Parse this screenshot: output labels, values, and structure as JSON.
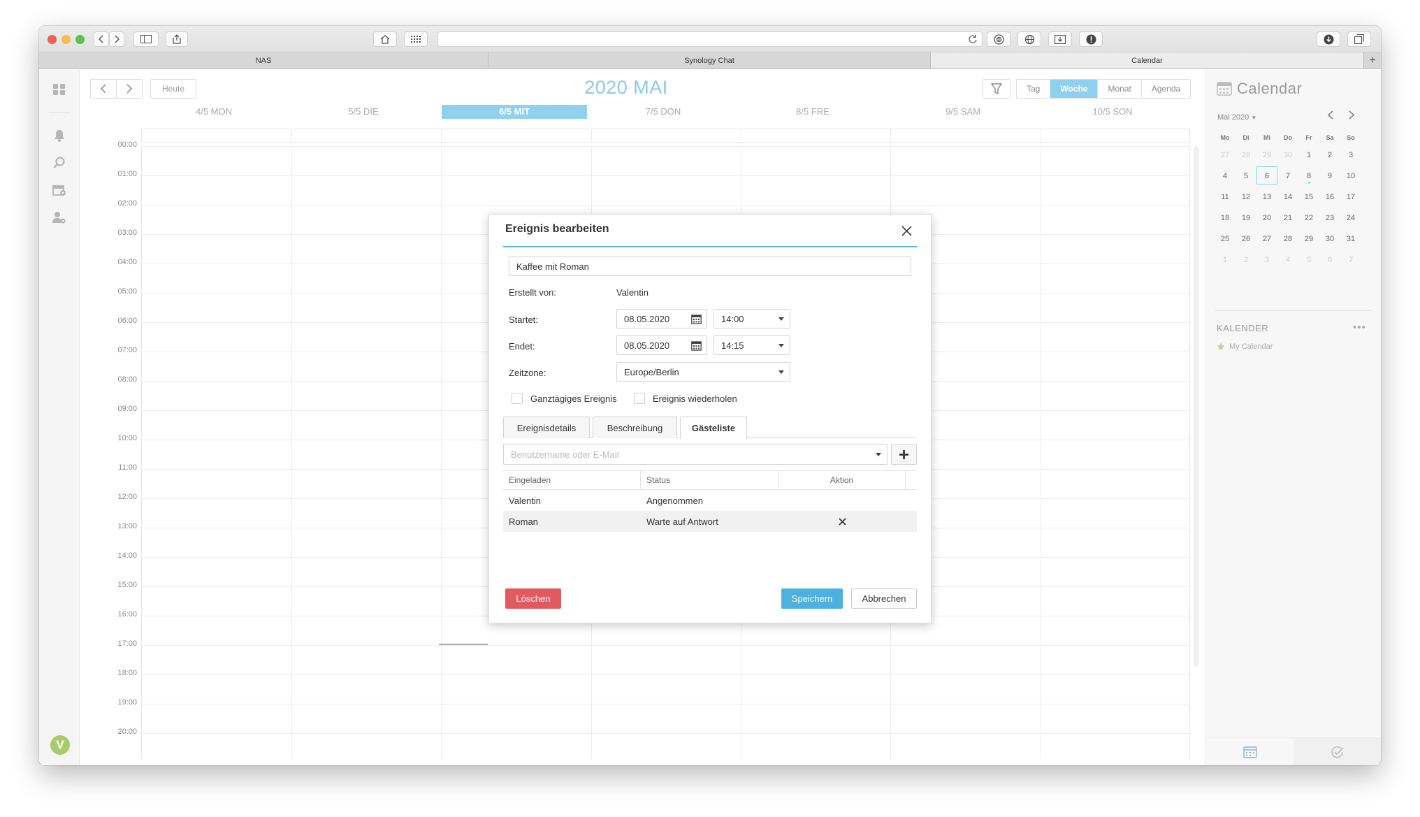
{
  "browser": {
    "tabs": [
      {
        "label": "NAS",
        "active": false
      },
      {
        "label": "Synology Chat",
        "active": false
      },
      {
        "label": "Calendar",
        "active": true
      }
    ],
    "new_tab_label": "+"
  },
  "header": {
    "today_label": "Heute",
    "title": "2020 MAI",
    "views": [
      {
        "label": "Tag",
        "active": false
      },
      {
        "label": "Woche",
        "active": true
      },
      {
        "label": "Monat",
        "active": false
      },
      {
        "label": "Agenda",
        "active": false
      }
    ]
  },
  "week": {
    "days": [
      {
        "label": "4/5 MON",
        "today": false
      },
      {
        "label": "5/5 DIE",
        "today": false
      },
      {
        "label": "6/5 MIT",
        "today": true
      },
      {
        "label": "7/5 DON",
        "today": false
      },
      {
        "label": "8/5 FRE",
        "today": false
      },
      {
        "label": "9/5 SAM",
        "today": false
      },
      {
        "label": "10/5 SON",
        "today": false
      }
    ],
    "hours": [
      "00:00",
      "01:00",
      "02:00",
      "03:00",
      "04:00",
      "05:00",
      "06:00",
      "07:00",
      "08:00",
      "09:00",
      "10:00",
      "11:00",
      "12:00",
      "13:00",
      "14:00",
      "15:00",
      "16:00",
      "17:00",
      "18:00",
      "19:00",
      "20:00"
    ]
  },
  "user": {
    "avatar_letter": "V"
  },
  "sidebar": {
    "title": "Calendar",
    "mini_month": "Mai 2020",
    "weekday_headers": [
      "Mo",
      "Di",
      "Mi",
      "Do",
      "Fr",
      "Sa",
      "So"
    ],
    "weeks": [
      [
        "27",
        "28",
        "29",
        "30",
        "1",
        "2",
        "3"
      ],
      [
        "4",
        "5",
        "6",
        "7",
        "8",
        "9",
        "10"
      ],
      [
        "11",
        "12",
        "13",
        "14",
        "15",
        "16",
        "17"
      ],
      [
        "18",
        "19",
        "20",
        "21",
        "22",
        "23",
        "24"
      ],
      [
        "25",
        "26",
        "27",
        "28",
        "29",
        "30",
        "31"
      ],
      [
        "1",
        "2",
        "3",
        "4",
        "5",
        "6",
        "7"
      ]
    ],
    "calendars_heading": "KALENDER",
    "more_label": "•••",
    "calendars": [
      {
        "name": "My Calendar",
        "color": "#a8cc6c"
      }
    ]
  },
  "dialog": {
    "title": "Ereignis bearbeiten",
    "event_title": "Kaffee mit Roman",
    "created_by_label": "Erstellt von:",
    "created_by": "Valentin",
    "start_label": "Startet:",
    "start_date": "08.05.2020",
    "start_time": "14:00",
    "end_label": "Endet:",
    "end_date": "08.05.2020",
    "end_time": "14:15",
    "timezone_label": "Zeitzone:",
    "timezone": "Europe/Berlin",
    "all_day_label": "Ganztägiges Ereignis",
    "all_day_checked": false,
    "repeat_label": "Ereignis wiederholen",
    "repeat_checked": false,
    "tabs": [
      {
        "label": "Ereignisdetails",
        "active": false
      },
      {
        "label": "Beschreibung",
        "active": false
      },
      {
        "label": "Gästeliste",
        "active": true
      }
    ],
    "guest_placeholder": "Benutzername oder E-Mail",
    "guest_columns": [
      "Eingeladen",
      "Status",
      "Aktion"
    ],
    "guests": [
      {
        "name": "Valentin",
        "status": "Angenommen",
        "removable": false
      },
      {
        "name": "Roman",
        "status": "Warte auf Antwort",
        "removable": true
      }
    ],
    "delete_label": "Löschen",
    "save_label": "Speichern",
    "cancel_label": "Abbrechen"
  },
  "colors": {
    "accent": "#8fd0ef",
    "primary": "#4cb1e1",
    "danger": "#e05a5f"
  }
}
